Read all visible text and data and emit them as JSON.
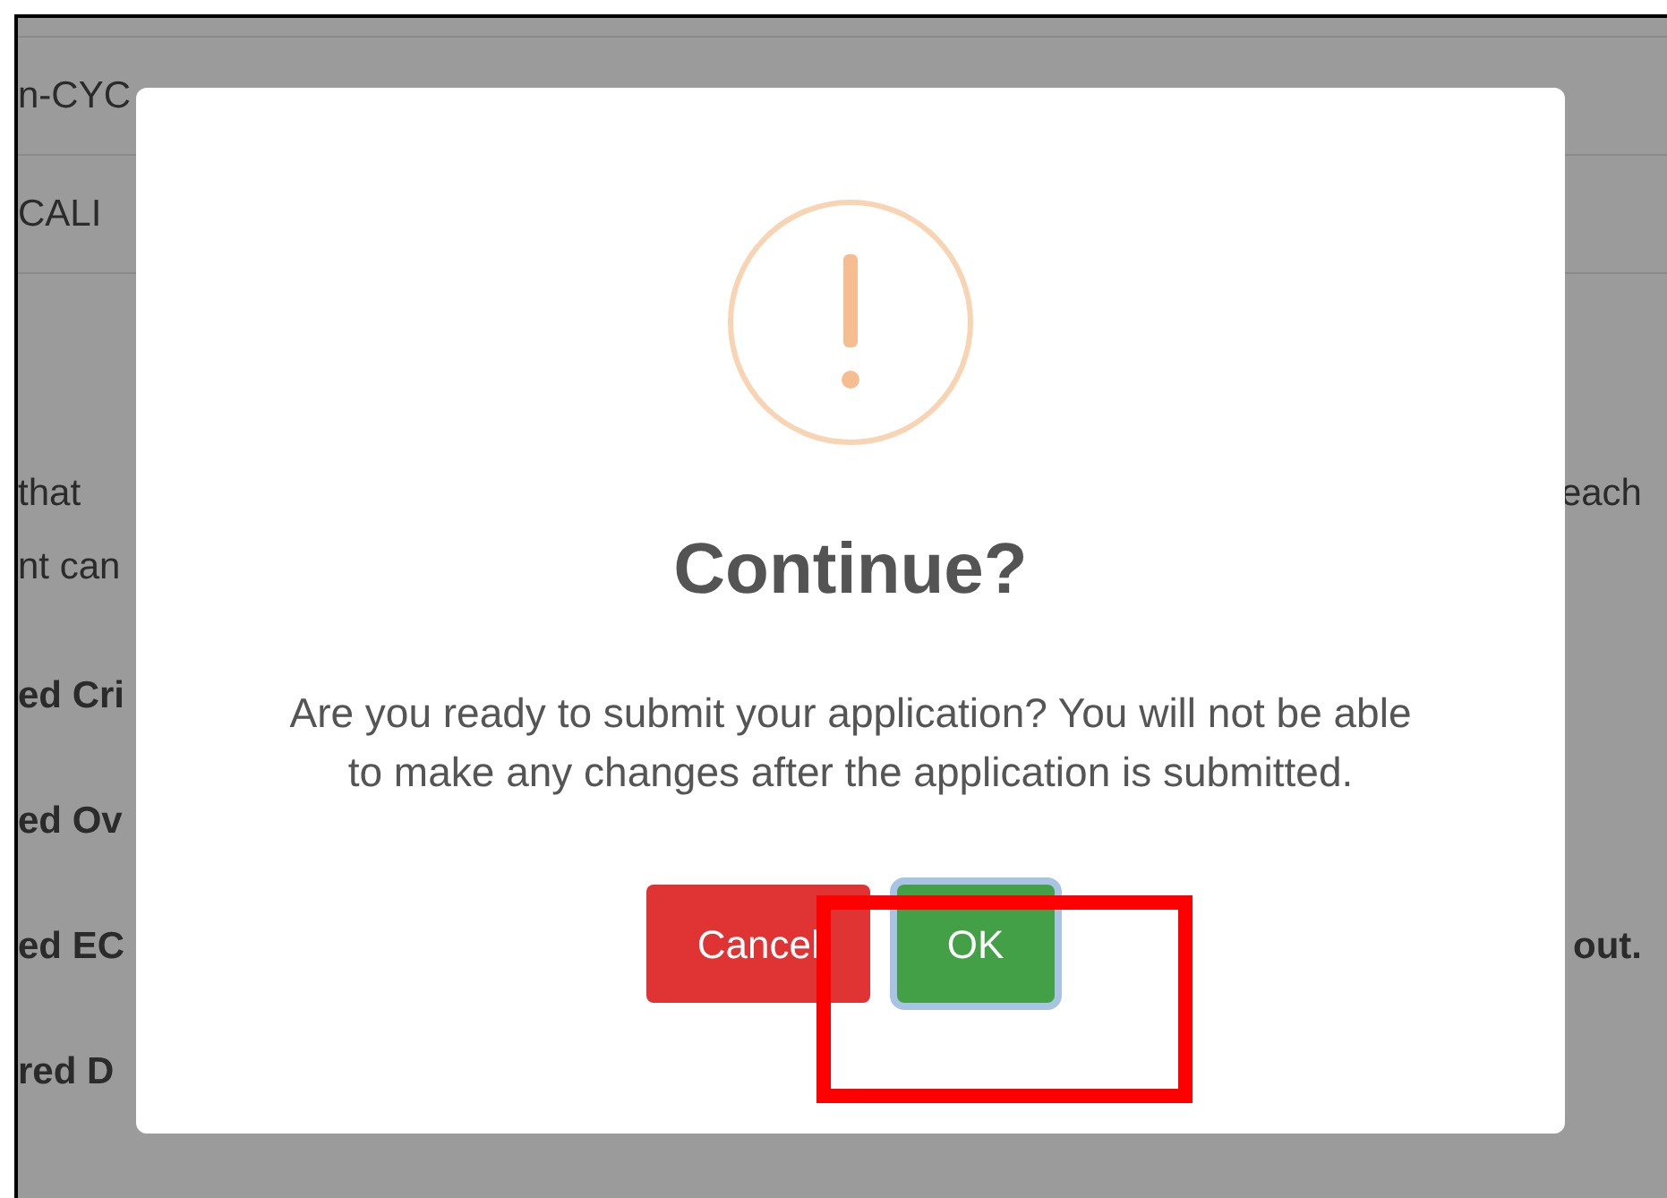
{
  "background": {
    "rows": [
      {
        "left": "n-CYC"
      },
      {
        "left": "CALI"
      }
    ],
    "lines": [
      {
        "left": "that",
        "right": "each",
        "bold": false
      },
      {
        "left": "nt can",
        "bold": false
      },
      {
        "left": "ed Cri",
        "bold": true
      },
      {
        "left": "ed Ov",
        "bold": true
      },
      {
        "left": "ed EC",
        "right": "out.",
        "bold": true
      },
      {
        "left": "red D",
        "bold": true
      }
    ]
  },
  "dialog": {
    "title": "Continue?",
    "message": "Are you ready to submit your application? You will not be able to make any changes after the application is submitted.",
    "buttons": [
      {
        "label": "Cancel",
        "kind": "cancel",
        "focused": false
      },
      {
        "label": "OK",
        "kind": "confirm",
        "focused": true
      }
    ]
  }
}
